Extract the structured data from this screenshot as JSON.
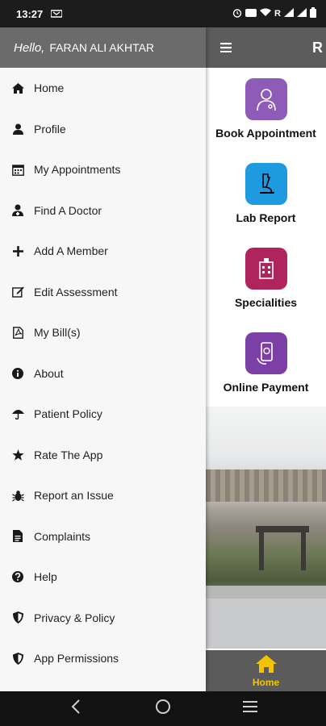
{
  "status": {
    "time": "13:27",
    "network": "R"
  },
  "topbar": {
    "title": "R"
  },
  "drawer": {
    "greeting": "Hello,",
    "user_name": "FARAN ALI AKHTAR",
    "items": [
      {
        "label": "Home",
        "icon": "home-icon"
      },
      {
        "label": "Profile",
        "icon": "user-icon"
      },
      {
        "label": "My Appointments",
        "icon": "calendar-icon"
      },
      {
        "label": "Find A Doctor",
        "icon": "doctor-icon"
      },
      {
        "label": "Add A Member",
        "icon": "plus-icon"
      },
      {
        "label": "Edit Assessment",
        "icon": "edit-icon"
      },
      {
        "label": "My Bill(s)",
        "icon": "pdf-icon"
      },
      {
        "label": "About",
        "icon": "info-icon"
      },
      {
        "label": "Patient Policy",
        "icon": "umbrella-icon"
      },
      {
        "label": "Rate The App",
        "icon": "star-icon"
      },
      {
        "label": "Report an Issue",
        "icon": "bug-icon"
      },
      {
        "label": "Complaints",
        "icon": "document-icon"
      },
      {
        "label": "Help",
        "icon": "question-icon"
      },
      {
        "label": "Privacy & Policy",
        "icon": "shield-icon"
      },
      {
        "label": "App Permissions",
        "icon": "shield-icon"
      }
    ]
  },
  "tiles": [
    {
      "label": "Book Appointment",
      "icon": "doctor-appointment-icon",
      "color": "#8e5bb8"
    },
    {
      "label": "Lab Report",
      "icon": "microscope-icon",
      "color": "#1e9be0"
    },
    {
      "label": "Specialities",
      "icon": "hospital-icon",
      "color": "#b0245e"
    },
    {
      "label": "Online Payment",
      "icon": "phone-payment-icon",
      "color": "#7b3fa6"
    }
  ],
  "bottom_nav": {
    "home_label": "Home",
    "active_color": "#f5c400"
  },
  "colors": {
    "drawer_header": "#6b6b6b",
    "topbar": "#5c5c5c"
  }
}
